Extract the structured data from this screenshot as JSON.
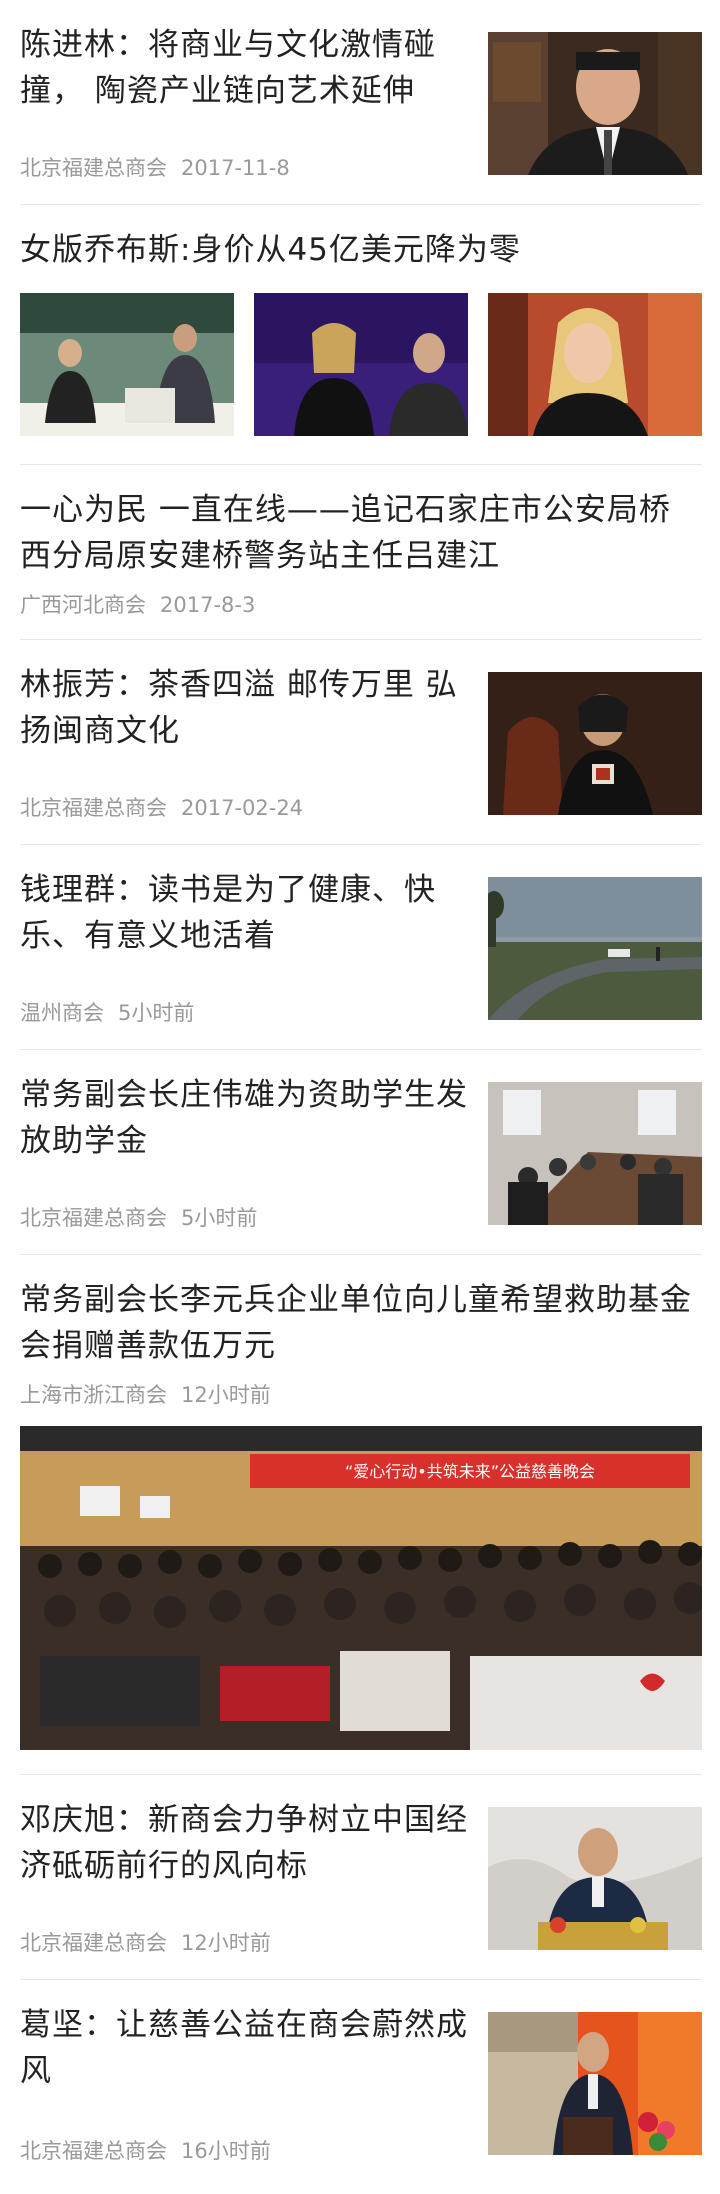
{
  "items": [
    {
      "title": "陈进林：将商业与文化激情碰撞，  陶瓷产业链向艺术延伸",
      "source": "北京福建总商会",
      "time": "2017-11-8"
    },
    {
      "title": "女版乔布斯:身价从45亿美元降为零"
    },
    {
      "title": "一心为民   一直在线——追记石家庄市公安局桥西分局原安建桥警务站主任吕建江",
      "source": "广西河北商会",
      "time": "2017-8-3"
    },
    {
      "title": "林振芳：茶香四溢  邮传万里  弘扬闽商文化",
      "source": "北京福建总商会",
      "time": "2017-02-24"
    },
    {
      "title": "钱理群：读书是为了健康、快乐、有意义地活着",
      "source": "温州商会",
      "time": "5小时前"
    },
    {
      "title": "常务副会长庄伟雄为资助学生发放助学金",
      "source": "北京福建总商会",
      "time": "5小时前"
    },
    {
      "title": "常务副会长李元兵企业单位向儿童希望救助基金会捐赠善款伍万元",
      "source": "上海市浙江商会",
      "time": "12小时前",
      "banner": "“爱心行动•共筑未来”公益慈善晚会"
    },
    {
      "title": "邓庆旭：新商会力争树立中国经济砥砺前行的风向标",
      "source": "北京福建总商会",
      "time": "12小时前"
    },
    {
      "title": "葛坚：让慈善公益在商会蔚然成风",
      "source": "北京福建总商会",
      "time": "16小时前"
    }
  ]
}
